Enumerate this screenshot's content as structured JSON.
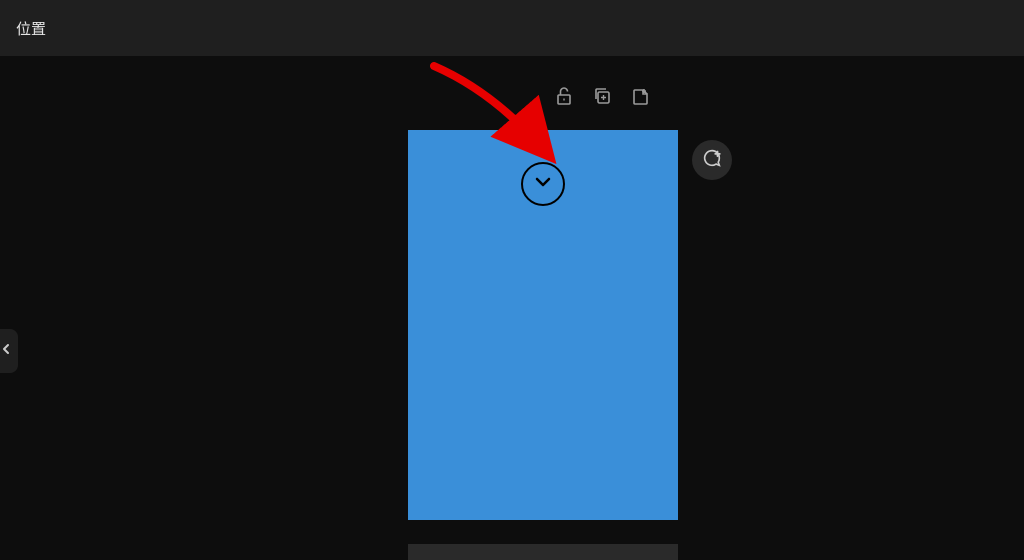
{
  "topbar": {
    "title": "位置"
  },
  "toolbar": {
    "lock_icon": "lock",
    "copy_icon": "copy-plus",
    "new_icon": "new-page"
  },
  "panel": {
    "color": "#3a8fd9",
    "dropdown_icon": "chevron-down"
  },
  "floating": {
    "comment_icon": "comment-plus"
  },
  "edge": {
    "collapse_icon": "chevron-left"
  }
}
